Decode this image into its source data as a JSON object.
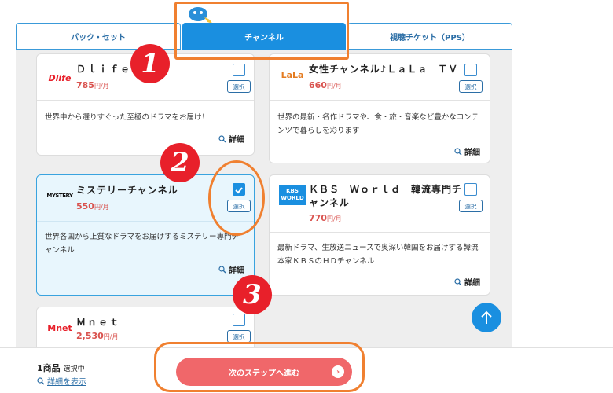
{
  "tabs": [
    {
      "label": "パック・セット"
    },
    {
      "label": "チャンネル"
    },
    {
      "label": "視聴チケット（PPS）"
    }
  ],
  "channels": [
    {
      "name": "Ｄｌｉｆｅ",
      "price": "785",
      "unit": "円/月",
      "desc": "世界中から選りすぐった至極のドラマをお届け！",
      "logo": "Dlife",
      "selected": false
    },
    {
      "name": "女性チャンネル♪ＬａＬａ　ＴＶ",
      "price": "660",
      "unit": "円/月",
      "desc": "世界の最新・名作ドラマや、食・旅・音楽など豊かなコンテンツで暮らしを彩ります",
      "logo": "LaLa",
      "selected": false
    },
    {
      "name": "ミステリーチャンネル",
      "price": "550",
      "unit": "円/月",
      "desc": "世界各国から上質なドラマをお届けするミステリー専門チャンネル",
      "logo": "MYSTERY",
      "selected": true
    },
    {
      "name": "ＫＢＳ　Ｗｏｒｌｄ　韓流専門チャンネル",
      "price": "770",
      "unit": "円/月",
      "desc": "最新ドラマ、生放送ニュースで奥深い韓国をお届けする韓流本家ＫＢＳのＨＤチャンネル",
      "logo": "KBS WORLD",
      "selected": false
    },
    {
      "name": "Ｍｎｅｔ",
      "price": "2,530",
      "unit": "円/月",
      "desc": "",
      "logo": "Mnet",
      "selected": false
    }
  ],
  "select_label": "選択",
  "detail_label": "詳細",
  "badges": [
    "1",
    "2",
    "3"
  ],
  "bottom": {
    "count": "1商品",
    "count_sub": "選択中",
    "show_detail": "詳細を表示",
    "next_label": "次のステップへ進む"
  },
  "colors": {
    "accent": "#1a8fe0",
    "price": "#d9534f",
    "annotation": "#f08030",
    "badge": "#e8202a",
    "next": "#f0676a"
  }
}
